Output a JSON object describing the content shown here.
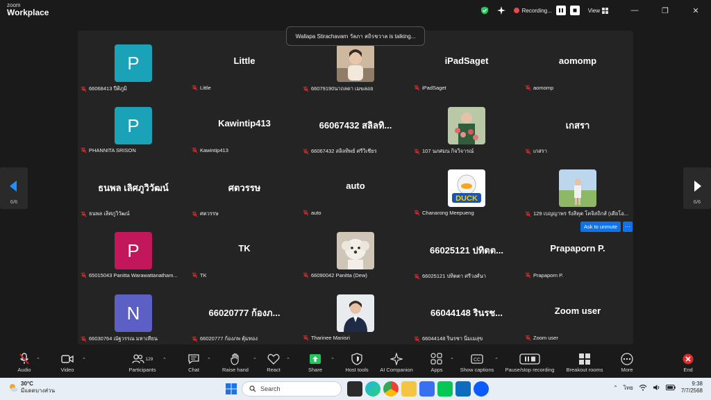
{
  "app": {
    "logo_top": "zoom",
    "logo_bottom": "Workplace"
  },
  "titlebar": {
    "recording_label": "Recording...",
    "view_label": "View"
  },
  "talking_banner": "Wallapa Stirachavarn วัลภา สถิรชวาล is talking...",
  "pager": {
    "left_label": "6/6",
    "right_label": "6/6"
  },
  "participants": [
    {
      "big": "",
      "avatar_letter": "P",
      "avatar_color": "#1aa3b8",
      "name": "66068413 ปีติภูมิ"
    },
    {
      "big": "Little",
      "name": "Little"
    },
    {
      "big": "",
      "photo": "woman",
      "name": "66079190นาถลดา เมฆลอย"
    },
    {
      "big": "iPadSaget",
      "name": "iPadSaget"
    },
    {
      "big": "aomomp",
      "name": "aomomp"
    },
    {
      "big": "",
      "avatar_letter": "P",
      "avatar_color": "#1aa3b8",
      "name": "PHANNITA SRISON"
    },
    {
      "big": "Kawintip413",
      "name": "Kawintip413"
    },
    {
      "big": "66067432 สลิลทิ...",
      "name": "66067432 สลิลทิพย์ ศรีวิเชียร"
    },
    {
      "big": "",
      "photo": "flowers",
      "name": "107 นภศมน กิจวิจารณ์"
    },
    {
      "big": "เกสรา",
      "name": "เกสรา"
    },
    {
      "big": "ธนพล เลิศภูวิวัฒน์",
      "name": "ธนพล เลิศภูวิวัฒน์"
    },
    {
      "big": "ศตวรรษ",
      "name": "ศตวรรษ"
    },
    {
      "big": "auto",
      "name": "auto"
    },
    {
      "big": "",
      "photo": "duck",
      "name": "Chanarong Meepueng"
    },
    {
      "big": "",
      "photo": "field",
      "name": "129 เบญญาพร รังสิคุต โคจิสถิกส์ (เดียโอ..."
    },
    {
      "big": "",
      "avatar_letter": "P",
      "avatar_color": "#c2185b",
      "name": "65015043 Panitta Warawattanatham..."
    },
    {
      "big": "TK",
      "name": "TK"
    },
    {
      "big": "",
      "photo": "dog",
      "name": "66090042 Panitta (Dew)"
    },
    {
      "big": "66025121 ปทิตต...",
      "name": "66025121 ปทิตตา ศรีวงศ์นา"
    },
    {
      "big": "Prapaporn P.",
      "name": "Prapaporn P."
    },
    {
      "big": "",
      "avatar_letter": "N",
      "avatar_color": "#5c5fc4",
      "name": "66030764 ณัฐวรรณ มหาเทียน"
    },
    {
      "big": "66020777 ก้องภ...",
      "name": "66020777 ก้องภพ ตุ้มทอง"
    },
    {
      "big": "",
      "photo": "portrait",
      "name": "Tharinee Manisri"
    },
    {
      "big": "66044148 รินรช...",
      "name": "66044148 รินรชา นิ่มเมสุข"
    },
    {
      "big": "Zoom user",
      "name": "Zoom user"
    }
  ],
  "ask_to_unmute": "Ask to unmute",
  "ask_more": "···",
  "toolbar": {
    "audio": "Audio",
    "video": "Video",
    "participants": "Participants",
    "participants_count": "129",
    "chat": "Chat",
    "raise_hand": "Raise hand",
    "react": "React",
    "share": "Share",
    "host_tools": "Host tools",
    "ai_companion": "AI Companion",
    "apps": "Apps",
    "show_captions": "Show captions",
    "pause_recording": "Pause/stop recording",
    "breakout_rooms": "Breakout rooms",
    "more": "More",
    "end": "End"
  },
  "taskbar": {
    "temp": "30°C",
    "weather_desc": "มีแดดบางส่วน",
    "search_placeholder": "Search",
    "lang": "ไทย",
    "time": "9:38",
    "date": "7/7/2568"
  },
  "colors": {
    "accent": "#0e72ed",
    "end_red": "#e02828",
    "share_green": "#22c55e"
  }
}
